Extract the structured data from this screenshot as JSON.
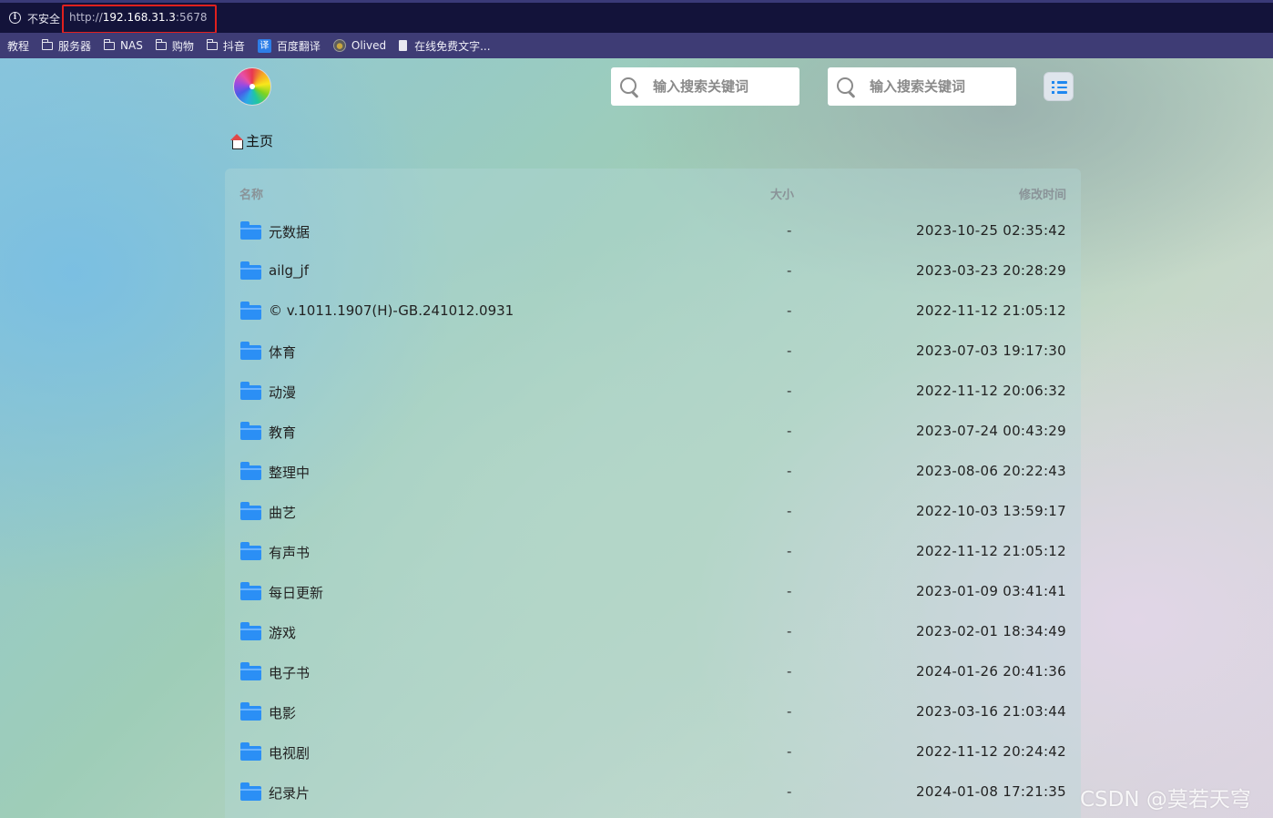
{
  "browser": {
    "security_label": "不安全",
    "url_scheme": "http://",
    "url_host": "192.168.31.3",
    "url_port": ":5678"
  },
  "bookmarks": [
    {
      "label": "教程",
      "icon": "none"
    },
    {
      "label": "服务器",
      "icon": "folder-icon"
    },
    {
      "label": "NAS",
      "icon": "folder-icon"
    },
    {
      "label": "购物",
      "icon": "folder-icon"
    },
    {
      "label": "抖音",
      "icon": "folder-icon"
    },
    {
      "label": "百度翻译",
      "icon": "translate-icon",
      "icon_text": "译"
    },
    {
      "label": "Olived",
      "icon": "olived-icon"
    },
    {
      "label": "在线免费文字...",
      "icon": "page-icon"
    }
  ],
  "header": {
    "search1_placeholder": "输入搜索关键词",
    "search2_placeholder": "输入搜索关键词"
  },
  "breadcrumb": {
    "home_label": "主页"
  },
  "file_list": {
    "columns": {
      "name": "名称",
      "size": "大小",
      "modified": "修改时间"
    },
    "rows": [
      {
        "name": "元数据",
        "size": "-",
        "modified": "2023-10-25 02:35:42"
      },
      {
        "name": "ailg_jf",
        "size": "-",
        "modified": "2023-03-23 20:28:29"
      },
      {
        "name": "© v.1011.1907(H)-GB.241012.0931",
        "size": "-",
        "modified": "2022-11-12 21:05:12"
      },
      {
        "name": "体育",
        "size": "-",
        "modified": "2023-07-03 19:17:30"
      },
      {
        "name": "动漫",
        "size": "-",
        "modified": "2022-11-12 20:06:32"
      },
      {
        "name": "教育",
        "size": "-",
        "modified": "2023-07-24 00:43:29"
      },
      {
        "name": "整理中",
        "size": "-",
        "modified": "2023-08-06 20:22:43"
      },
      {
        "name": "曲艺",
        "size": "-",
        "modified": "2022-10-03 13:59:17"
      },
      {
        "name": "有声书",
        "size": "-",
        "modified": "2022-11-12 21:05:12"
      },
      {
        "name": "每日更新",
        "size": "-",
        "modified": "2023-01-09 03:41:41"
      },
      {
        "name": "游戏",
        "size": "-",
        "modified": "2023-02-01 18:34:49"
      },
      {
        "name": "电子书",
        "size": "-",
        "modified": "2024-01-26 20:41:36"
      },
      {
        "name": "电影",
        "size": "-",
        "modified": "2023-03-16 21:03:44"
      },
      {
        "name": "电视剧",
        "size": "-",
        "modified": "2022-11-12 20:24:42"
      },
      {
        "name": "纪录片",
        "size": "-",
        "modified": "2024-01-08 17:21:35"
      }
    ]
  },
  "watermark": "CSDN @莫若天穹",
  "colors": {
    "accent": "#2b8ff5",
    "url_highlight": "#e0201e",
    "address_bar_bg": "#13133a",
    "bookmarks_bar_bg": "#3e3c75"
  }
}
